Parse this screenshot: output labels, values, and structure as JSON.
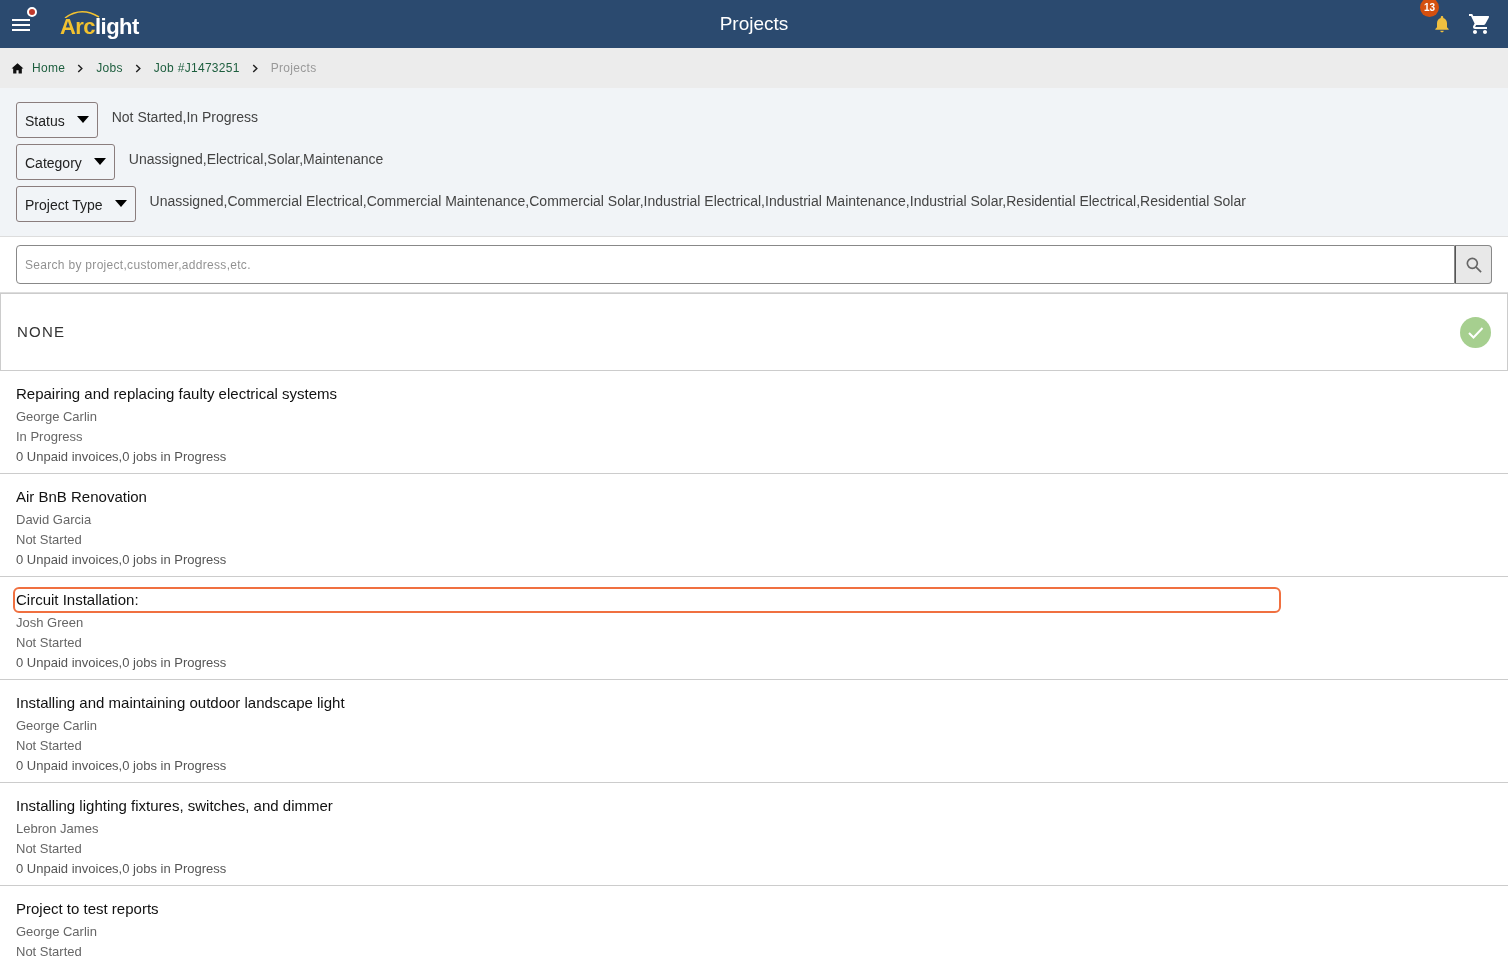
{
  "header": {
    "title": "Projects",
    "menu_badge": true,
    "logo": {
      "part1": "Arc",
      "part2": "light"
    },
    "notifications": "13"
  },
  "breadcrumb": [
    {
      "label": "Home",
      "current": false
    },
    {
      "label": "Jobs",
      "current": false
    },
    {
      "label": "Job #J1473251",
      "current": false
    },
    {
      "label": "Projects",
      "current": true
    }
  ],
  "filters": [
    {
      "label": "Status",
      "value": "Not Started,In Progress"
    },
    {
      "label": "Category",
      "value": "Unassigned,Electrical,Solar,Maintenance"
    },
    {
      "label": "Project Type",
      "value": "Unassigned,Commercial Electrical,Commercial Maintenance,Commercial Solar,Industrial Electrical,Industrial Maintenance,Industrial Solar,Residential Electrical,Residential Solar"
    }
  ],
  "search": {
    "placeholder": "Search by project,customer,address,etc."
  },
  "none_option": {
    "label": "NONE",
    "selected": true
  },
  "projects": [
    {
      "title": "Repairing and replacing faulty electrical systems",
      "customer": "George Carlin",
      "status": "In Progress",
      "summary": "0 Unpaid invoices,0 jobs in Progress",
      "highlighted": false
    },
    {
      "title": "Air BnB Renovation",
      "customer": "David Garcia",
      "status": "Not Started",
      "summary": "0 Unpaid invoices,0 jobs in Progress",
      "highlighted": false
    },
    {
      "title": "Circuit Installation:",
      "customer": "Josh Green",
      "status": "Not Started",
      "summary": "0 Unpaid invoices,0 jobs in Progress",
      "highlighted": true
    },
    {
      "title": "Installing and maintaining outdoor landscape light",
      "customer": "George Carlin",
      "status": "Not Started",
      "summary": "0 Unpaid invoices,0 jobs in Progress",
      "highlighted": false
    },
    {
      "title": "Installing lighting fixtures, switches, and dimmer",
      "customer": "Lebron James",
      "status": "Not Started",
      "summary": "0 Unpaid invoices,0 jobs in Progress",
      "highlighted": false
    },
    {
      "title": "Project to test reports",
      "customer": "George Carlin",
      "status": "Not Started",
      "highlighted": false
    }
  ]
}
